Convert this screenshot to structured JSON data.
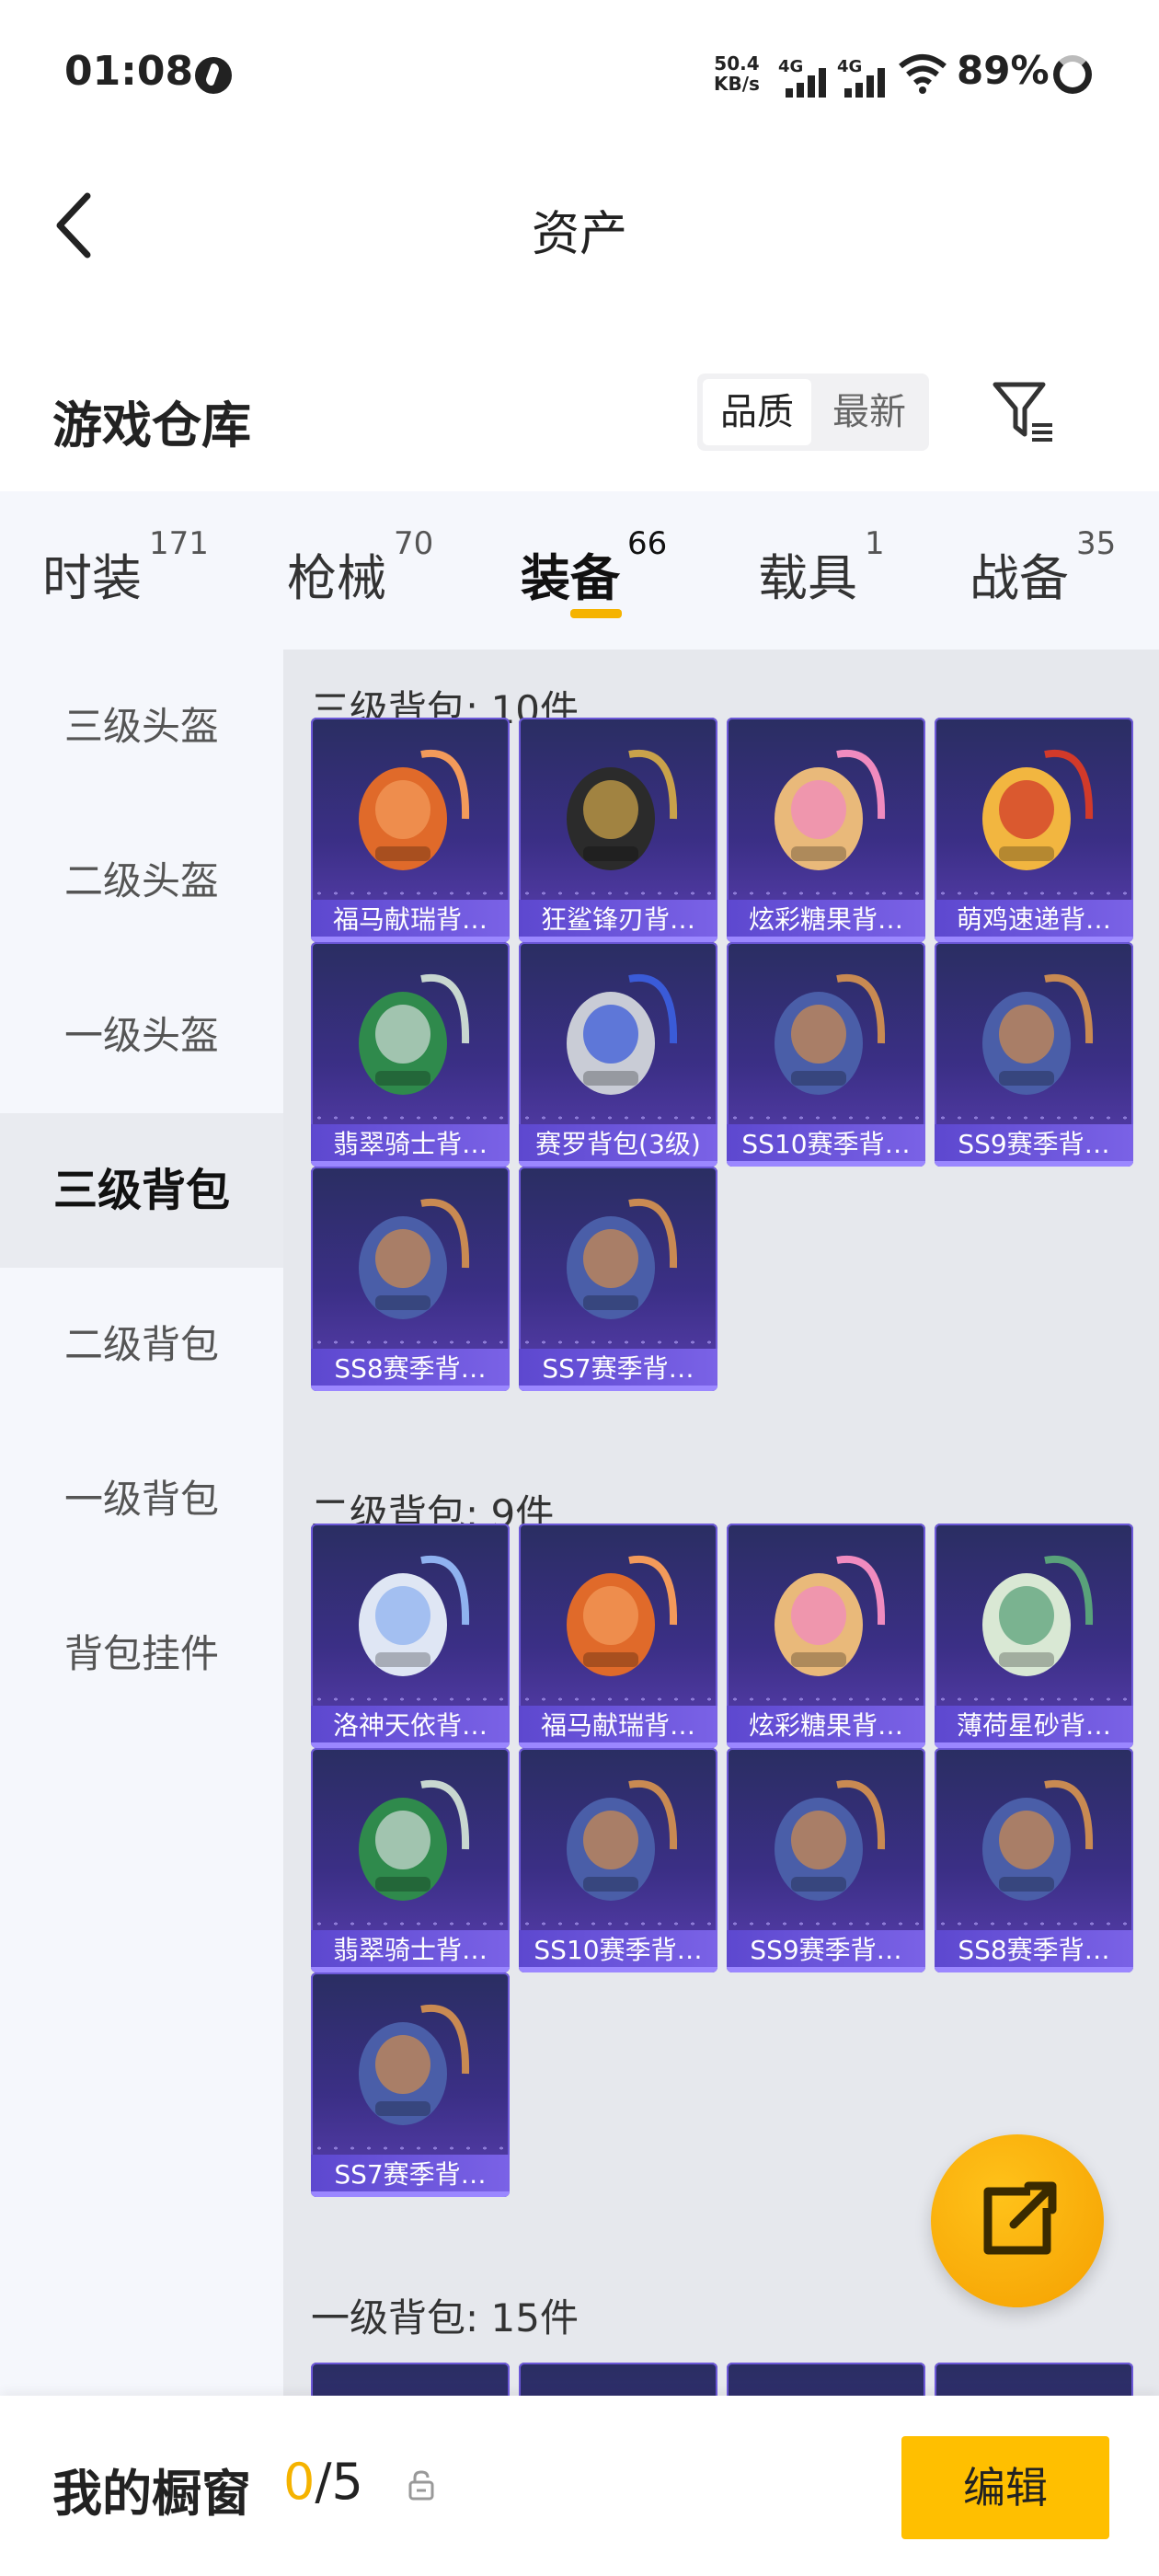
{
  "status": {
    "time": "01:08",
    "net_speed_value": "50.4",
    "net_speed_unit": "KB/s",
    "sim1": "4G",
    "sim2": "4G",
    "battery": "89%"
  },
  "nav": {
    "title": "资产"
  },
  "header": {
    "title": "游戏仓库",
    "sort_quality": "品质",
    "sort_newest": "最新"
  },
  "tabs": [
    {
      "label": "时装",
      "count": "171"
    },
    {
      "label": "枪械",
      "count": "70"
    },
    {
      "label": "装备",
      "count": "66"
    },
    {
      "label": "载具",
      "count": "1"
    },
    {
      "label": "战备",
      "count": "35"
    }
  ],
  "sidebar": {
    "items": [
      {
        "label": "三级头盔"
      },
      {
        "label": "二级头盔"
      },
      {
        "label": "一级头盔"
      },
      {
        "label": "三级背包"
      },
      {
        "label": "二级背包"
      },
      {
        "label": "一级背包"
      },
      {
        "label": "背包挂件"
      }
    ]
  },
  "groups": [
    {
      "title": "三级背包: 10件",
      "items": [
        {
          "name": "福马献瑞背…",
          "icon": "bunny-backpack-icon"
        },
        {
          "name": "狂鲨锋刃背…",
          "icon": "shark-backpack-icon"
        },
        {
          "name": "炫彩糖果背…",
          "icon": "donut-backpack-icon"
        },
        {
          "name": "萌鸡速递背…",
          "icon": "chick-backpack-icon"
        },
        {
          "name": "翡翠骑士背…",
          "icon": "knight-backpack-icon"
        },
        {
          "name": "赛罗背包(3级)",
          "icon": "jet-backpack-icon"
        },
        {
          "name": "SS10赛季背…",
          "icon": "season-backpack-icon"
        },
        {
          "name": "SS9赛季背…",
          "icon": "season-backpack-icon"
        },
        {
          "name": "SS8赛季背…",
          "icon": "season-backpack-icon"
        },
        {
          "name": "SS7赛季背…",
          "icon": "season-backpack-icon"
        }
      ]
    },
    {
      "title": "二级背包: 9件",
      "items": [
        {
          "name": "洛神天依背…",
          "icon": "angel-backpack-icon"
        },
        {
          "name": "福马献瑞背…",
          "icon": "bunny-backpack-icon"
        },
        {
          "name": "炫彩糖果背…",
          "icon": "donut-backpack-icon"
        },
        {
          "name": "薄荷星砂背…",
          "icon": "bag-backpack-icon"
        },
        {
          "name": "翡翠骑士背…",
          "icon": "knight-backpack-icon"
        },
        {
          "name": "SS10赛季背…",
          "icon": "season-backpack-icon"
        },
        {
          "name": "SS9赛季背…",
          "icon": "season-backpack-icon"
        },
        {
          "name": "SS8赛季背…",
          "icon": "season-backpack-icon"
        },
        {
          "name": "SS7赛季背…",
          "icon": "season-backpack-icon"
        }
      ]
    },
    {
      "title": "一级背包: 15件",
      "items": []
    }
  ],
  "shop": {
    "label": "我的橱窗",
    "current": "0",
    "sep_total": "/5",
    "edit": "编辑"
  },
  "colors": {
    "accent": "#f5b300",
    "card_top": "#2a2e62",
    "card_bottom": "#5a3fb0",
    "label_bar": "#6a53d8"
  }
}
